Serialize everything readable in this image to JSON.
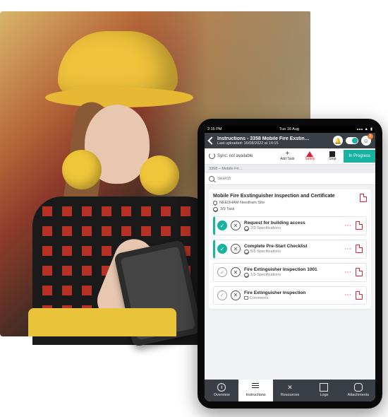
{
  "ios_status": {
    "time": "2:15 PM",
    "date": "Tue 16 Aug"
  },
  "header": {
    "title": "Instructions - 3358 Mobile Fire Exstin…",
    "subtitle": "Last uploaded: 16/08/2022 at 14:15",
    "badge_count": "2"
  },
  "toolbar": {
    "sync_label": "Sync: not available",
    "add_task": "Add Task",
    "safety": "Safety",
    "stop": "Stop",
    "status": "In Progress"
  },
  "breadcrumb": "3358 – Mobile Fir…",
  "search": {
    "placeholder": "Search"
  },
  "panel": {
    "title": "Mobile Fire Exstinguisher Inspection and Certificate",
    "site": "NEEDHAM Needham Site",
    "progress": "3/9 Task"
  },
  "tasks": [
    {
      "title": "Request for building access",
      "sub": "2/3 Specifications",
      "done": true
    },
    {
      "title": "Complete Pre-Start Checklist",
      "sub": "5/5 Specifications",
      "done": true
    },
    {
      "title": "Fire Extinguisher Inspection 1001",
      "sub": "1/9 Specifications",
      "done": false
    },
    {
      "title": "Fire Extinguisher Inspection",
      "sub": "Comments",
      "done": false
    }
  ],
  "bottom_nav": {
    "overview": "Overview",
    "instructions": "Instructions",
    "resources": "Resources",
    "logs": "Logs",
    "attachments": "Attachments"
  }
}
